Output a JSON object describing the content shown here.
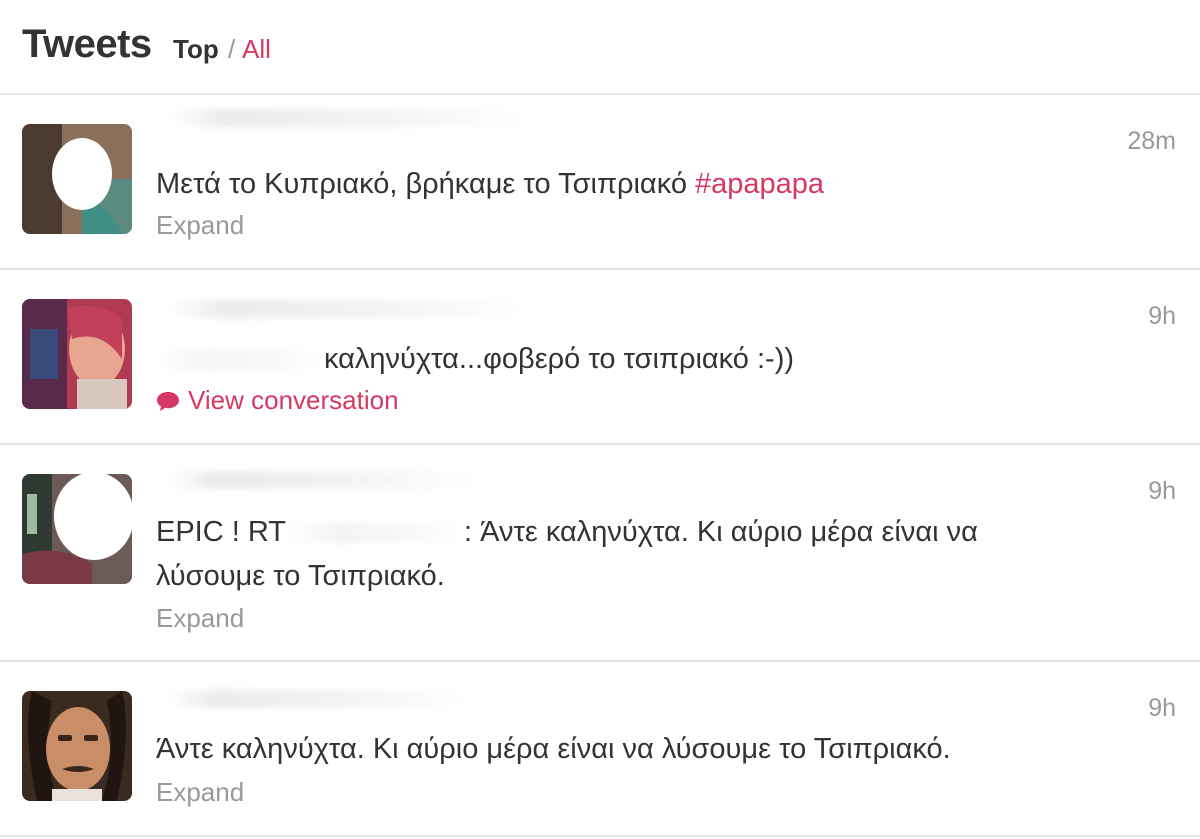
{
  "header": {
    "title": "Tweets",
    "filter_top": "Top",
    "separator": "/",
    "filter_all": "All"
  },
  "colors": {
    "accent": "#d63866",
    "muted": "#999999",
    "text": "#333333",
    "divider": "#e6e6e6"
  },
  "tweets": [
    {
      "time": "28m",
      "text_main": "Μετά το Κυπριακό, βρήκαμε το Τσιπριακό ",
      "hashtag": "#apapapa",
      "action": "Expand"
    },
    {
      "time": "9h",
      "text_main": "καληνύχτα...φοβερό το τσιπριακό :-))",
      "action": "View conversation",
      "action_icon": "speech-bubble-icon"
    },
    {
      "time": "9h",
      "text_prefix": "EPIC ! RT",
      "text_rest": ": Άντε καληνύχτα. Κι αύριο μέρα είναι να",
      "text_line2": "λύσουμε το Τσιπριακό.",
      "action": "Expand"
    },
    {
      "time": "9h",
      "text_main": "Άντε καληνύχτα. Κι αύριο μέρα είναι να λύσουμε το Τσιπριακό.",
      "action": "Expand"
    }
  ]
}
